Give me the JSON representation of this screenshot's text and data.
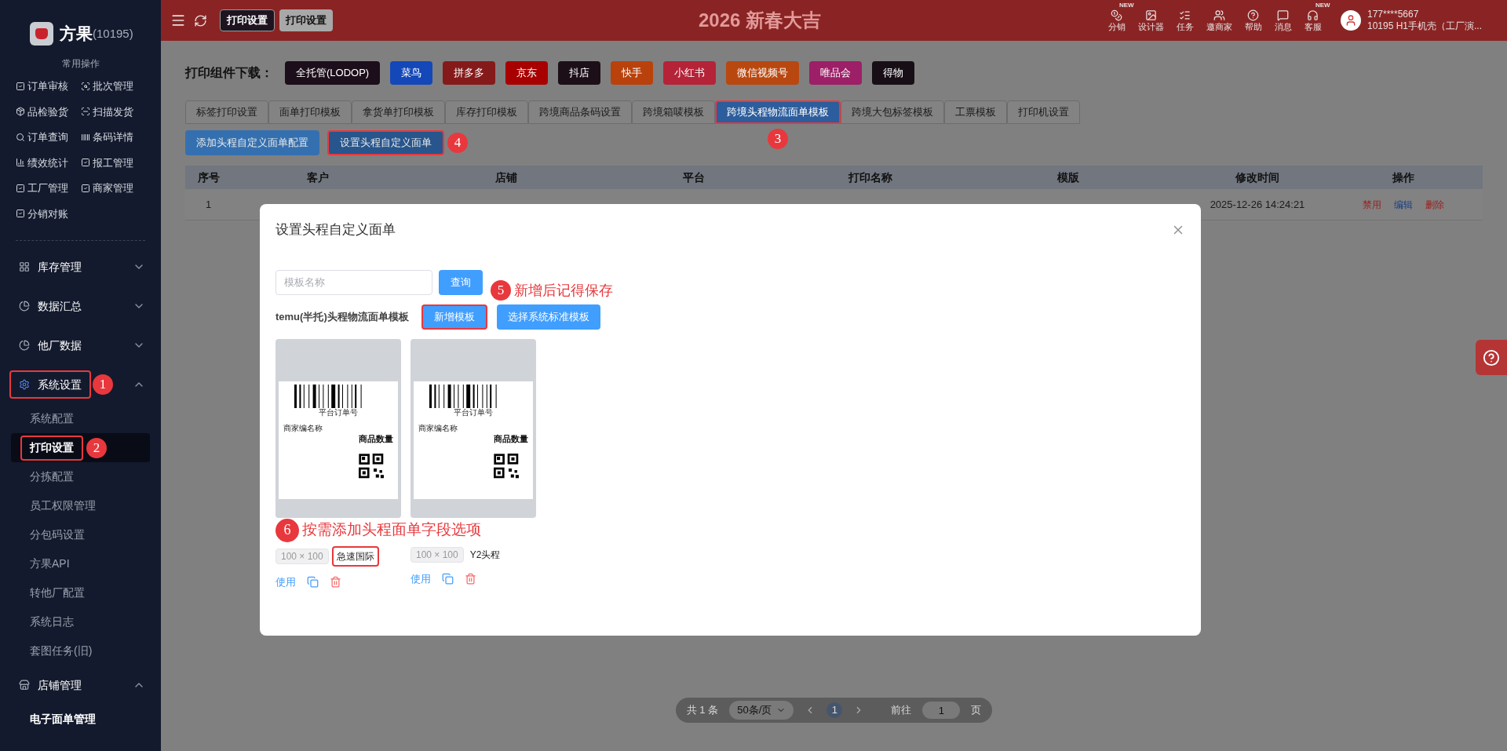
{
  "header": {
    "tabs": [
      {
        "label": "打印设置",
        "selected": true
      },
      {
        "label": "打印设置",
        "selected": false
      }
    ],
    "banner": "2026 新春大吉",
    "tools": [
      {
        "label": "分销",
        "badge": "NEW"
      },
      {
        "label": "设计器"
      },
      {
        "label": "任务"
      },
      {
        "label": "邀商家"
      },
      {
        "label": "帮助"
      },
      {
        "label": "消息"
      },
      {
        "label": "客服",
        "badge": "NEW"
      }
    ],
    "user": {
      "phone": "177****5667",
      "company": "10195 H1手机壳（工厂演..."
    }
  },
  "sidebar": {
    "brand": "方果",
    "account": "(10195)",
    "quick_title": "常用操作",
    "quick_actions": [
      {
        "label": "订单审核"
      },
      {
        "label": "批次管理"
      },
      {
        "label": "品检验货"
      },
      {
        "label": "扫描发货"
      },
      {
        "label": "订单查询"
      },
      {
        "label": "条码详情"
      },
      {
        "label": "绩效统计"
      },
      {
        "label": "报工管理"
      },
      {
        "label": "工厂管理"
      },
      {
        "label": "商家管理"
      },
      {
        "label": "分销对账"
      }
    ],
    "menu": [
      {
        "label": "库存管理",
        "expanded": false
      },
      {
        "label": "数据汇总",
        "expanded": false
      },
      {
        "label": "他厂数据",
        "expanded": false
      },
      {
        "label": "系统设置",
        "expanded": true,
        "marker": "1",
        "children": [
          {
            "label": "系统配置",
            "selected": false
          },
          {
            "label": "打印设置",
            "selected": true,
            "marker": "2"
          },
          {
            "label": "分拣配置",
            "selected": false
          },
          {
            "label": "员工权限管理",
            "selected": false
          },
          {
            "label": "分包码设置",
            "selected": false
          },
          {
            "label": "方果API",
            "selected": false
          },
          {
            "label": "转他厂配置",
            "selected": false
          },
          {
            "label": "系统日志",
            "selected": false
          },
          {
            "label": "套图任务(旧)",
            "selected": false
          }
        ]
      },
      {
        "label": "店铺管理",
        "expanded": true,
        "children": [
          {
            "label": "电子面单管理",
            "selected": false
          }
        ]
      }
    ]
  },
  "plugins": {
    "label": "打印组件下载：",
    "items": [
      {
        "label": "全托管(LODOP)",
        "color": "#1c0e1a"
      },
      {
        "label": "菜鸟",
        "color": "#1448b8"
      },
      {
        "label": "拼多多",
        "color": "#851a1a"
      },
      {
        "label": "京东",
        "color": "#a80000"
      },
      {
        "label": "抖店",
        "color": "#1c0f18"
      },
      {
        "label": "快手",
        "color": "#b9420c"
      },
      {
        "label": "小红书",
        "color": "#b52338"
      },
      {
        "label": "微信视频号",
        "color": "#b94810"
      },
      {
        "label": "唯品会",
        "color": "#9c1f67"
      },
      {
        "label": "得物",
        "color": "#180f16"
      }
    ]
  },
  "tabs": [
    {
      "label": "标签打印设置",
      "selected": false
    },
    {
      "label": "面单打印模板",
      "selected": false
    },
    {
      "label": "拿货单打印模板",
      "selected": false
    },
    {
      "label": "库存打印模板",
      "selected": false
    },
    {
      "label": "跨境商品条码设置",
      "selected": false
    },
    {
      "label": "跨境箱唛模板",
      "selected": false
    },
    {
      "label": "跨境头程物流面单模板",
      "selected": true,
      "marker": "3"
    },
    {
      "label": "跨境大包标签模板",
      "selected": false
    },
    {
      "label": "工票模板",
      "selected": false
    },
    {
      "label": "打印机设置",
      "selected": false
    }
  ],
  "actions": [
    {
      "label": "添加头程自定义面单配置"
    },
    {
      "label": "设置头程自定义面单",
      "marker": "4"
    }
  ],
  "table": {
    "columns": [
      "序号",
      "客户",
      "店铺",
      "平台",
      "打印名称",
      "模版",
      "修改时间",
      "操作"
    ],
    "rows": [
      {
        "index": "1",
        "modified": "2025-12-26 14:24:21",
        "actions": [
          {
            "label": "禁用",
            "kind": "danger"
          },
          {
            "label": "编辑",
            "kind": "primary"
          },
          {
            "label": "删除",
            "kind": "danger"
          }
        ]
      }
    ]
  },
  "pagination": {
    "total": "共 1 条",
    "page_size": "50条/页",
    "pages": [
      {
        "label": "1",
        "selected": true
      }
    ],
    "goto_label": "前往",
    "goto_value": "1",
    "goto_suffix": "页"
  },
  "modal": {
    "title": "设置头程自定义面单",
    "search": {
      "placeholder": "模板名称"
    },
    "search_button": "查询",
    "section_label": "temu(半托)头程物流面单模板",
    "buttons": [
      {
        "label": "新增模板",
        "marker": "5",
        "note": "新增后记得保存"
      },
      {
        "label": "选择系统标准模板"
      }
    ],
    "templates": [
      {
        "preview": {
          "order_no": "平台订单号",
          "merchant": "商家编名称",
          "quantity": "商品数量"
        },
        "size": "100 × 100",
        "name": "急速国际",
        "marker": "6",
        "note": "按需添加头程面单字段选项",
        "use": "使用"
      },
      {
        "preview": {
          "order_no": "平台订单号",
          "merchant": "商家编名称",
          "quantity": "商品数量"
        },
        "size": "100 × 100",
        "name": "Y2头程",
        "use": "使用"
      }
    ]
  }
}
